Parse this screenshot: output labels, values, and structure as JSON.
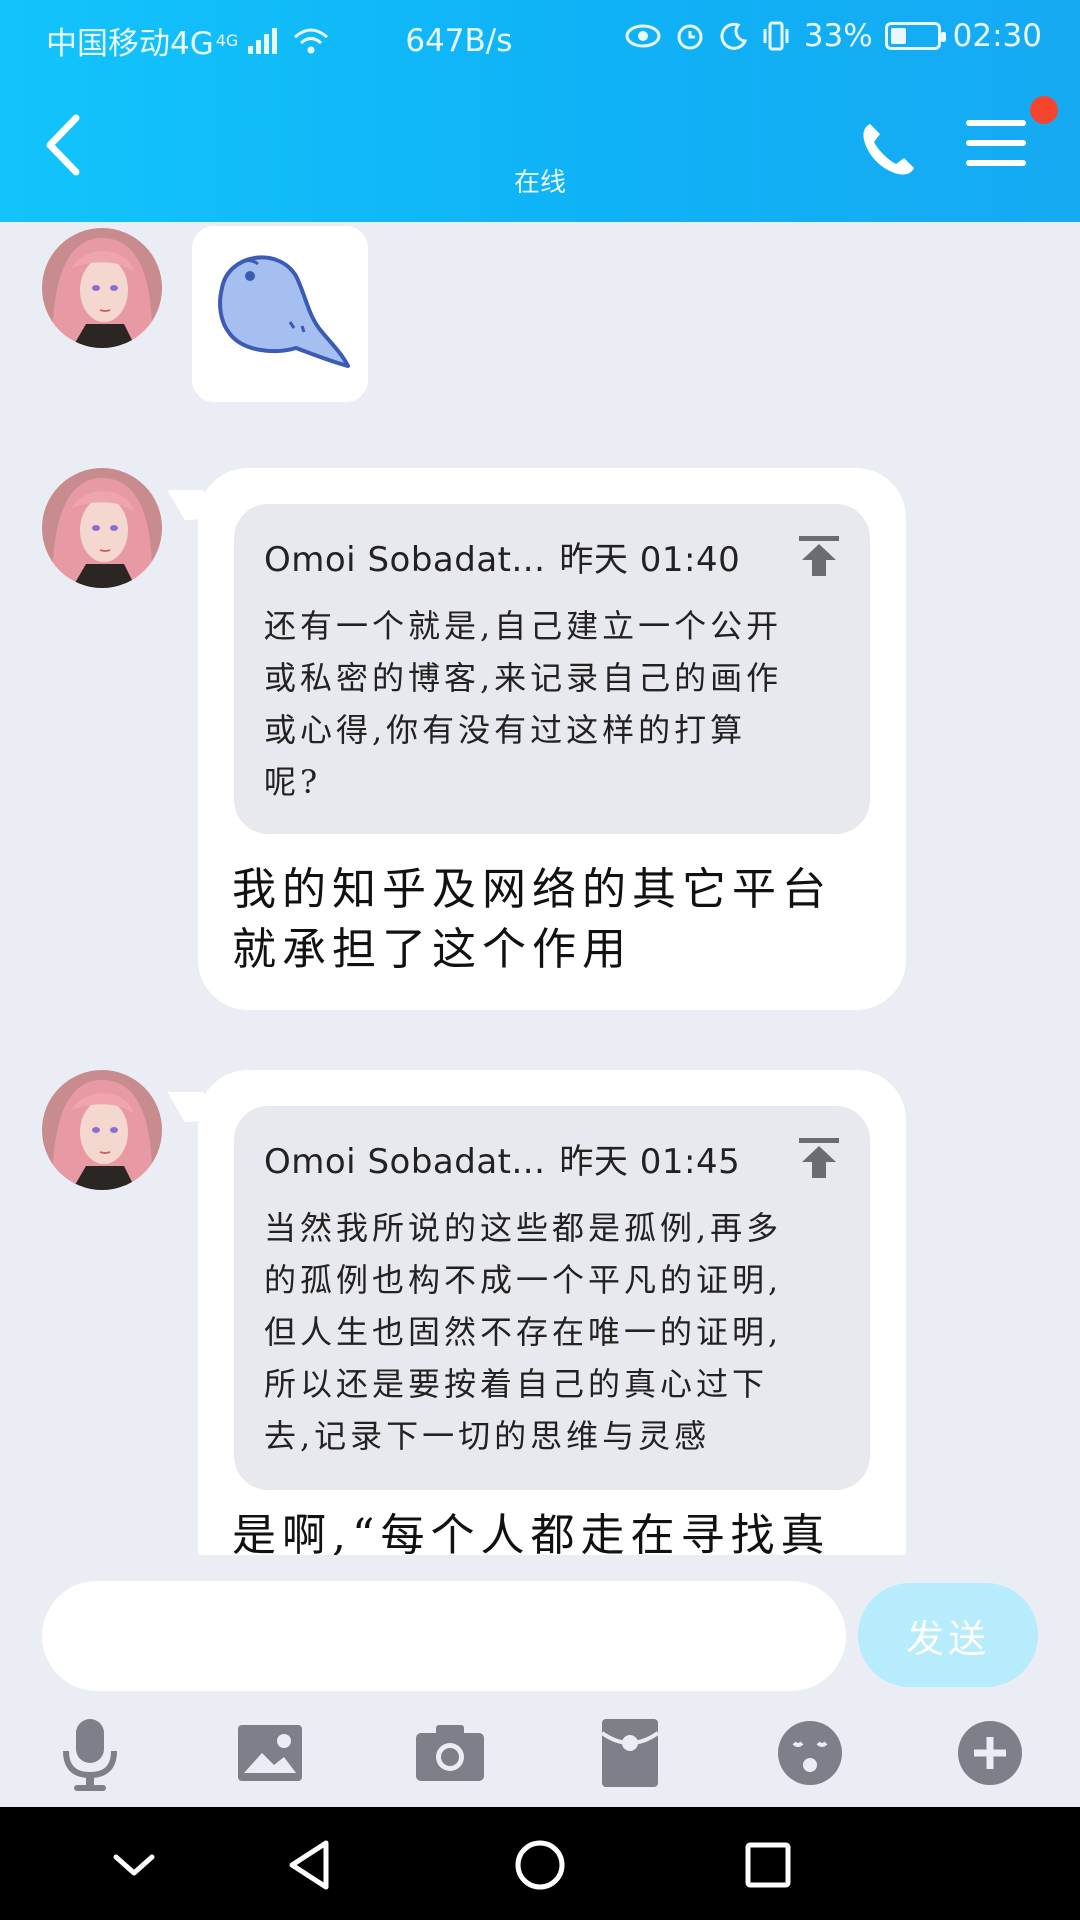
{
  "status_bar": {
    "carrier": "中国移动4G",
    "network_badge": "4G",
    "speed": "647B/s",
    "battery": "33%",
    "battery_level": 0.33,
    "time": "02:30"
  },
  "header": {
    "presence": "在线",
    "icons": [
      "back-arrow-icon",
      "phone-icon",
      "menu-icon"
    ],
    "colors": {
      "bar": "#12c4fb",
      "badge": "#f6452f"
    }
  },
  "messages": [
    {
      "type": "sticker",
      "icon": "bird-sticker"
    },
    {
      "type": "quote_reply",
      "quote_author": "Omoi Sobadat...",
      "quote_time": "昨天 01:40",
      "quote_lines": [
        "还有一个就是,自己建立一个公开",
        "或私密的博客,来记录自己的画作",
        "或心得,你有没有过这样的打算",
        "呢?"
      ],
      "reply_lines": [
        "我的知乎及网络的其它平台",
        "就承担了这个作用"
      ]
    },
    {
      "type": "quote_reply",
      "quote_author": "Omoi Sobadat...",
      "quote_time": "昨天 01:45",
      "quote_lines": [
        "当然我所说的这些都是孤例,再多",
        "的孤例也构不成一个平凡的证明,",
        "但人生也固然不存在唯一的证明,",
        "所以还是要按着自己的真心过下",
        "去,记录下一切的思维与灵感"
      ],
      "reply_lines": [
        "是啊,“每个人都走在寻找真"
      ]
    }
  ],
  "input": {
    "value": "",
    "send_label": "发送"
  },
  "toolbar": [
    "mic-icon",
    "image-icon",
    "camera-icon",
    "red-packet-icon",
    "emoji-icon",
    "plus-icon"
  ],
  "navbar": [
    "chevron-down-icon",
    "back-triangle-icon",
    "home-circle-icon",
    "recents-square-icon"
  ]
}
